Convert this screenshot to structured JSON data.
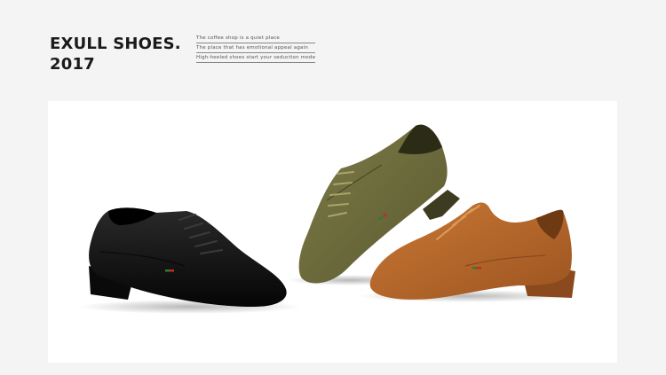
{
  "brand": {
    "line1": "EXULL SHOES.",
    "line2": "2017"
  },
  "taglines": [
    "The coffee shop is a quiet place",
    "The place that has emotional appeal again",
    "High-heeled shoes start your seduction mode"
  ],
  "products": {
    "shoes": [
      {
        "name": "black-suede-oxford",
        "color": "#121212"
      },
      {
        "name": "olive-suede-oxford",
        "color": "#6f6d3c"
      },
      {
        "name": "tan-suede-oxford",
        "color": "#b9682d"
      }
    ],
    "stripe_colors": [
      "#2e7d32",
      "#c62828"
    ]
  },
  "colors": {
    "page_background": "#f4f4f4",
    "panel_background": "#ffffff",
    "title_text": "#1a1a1a"
  }
}
